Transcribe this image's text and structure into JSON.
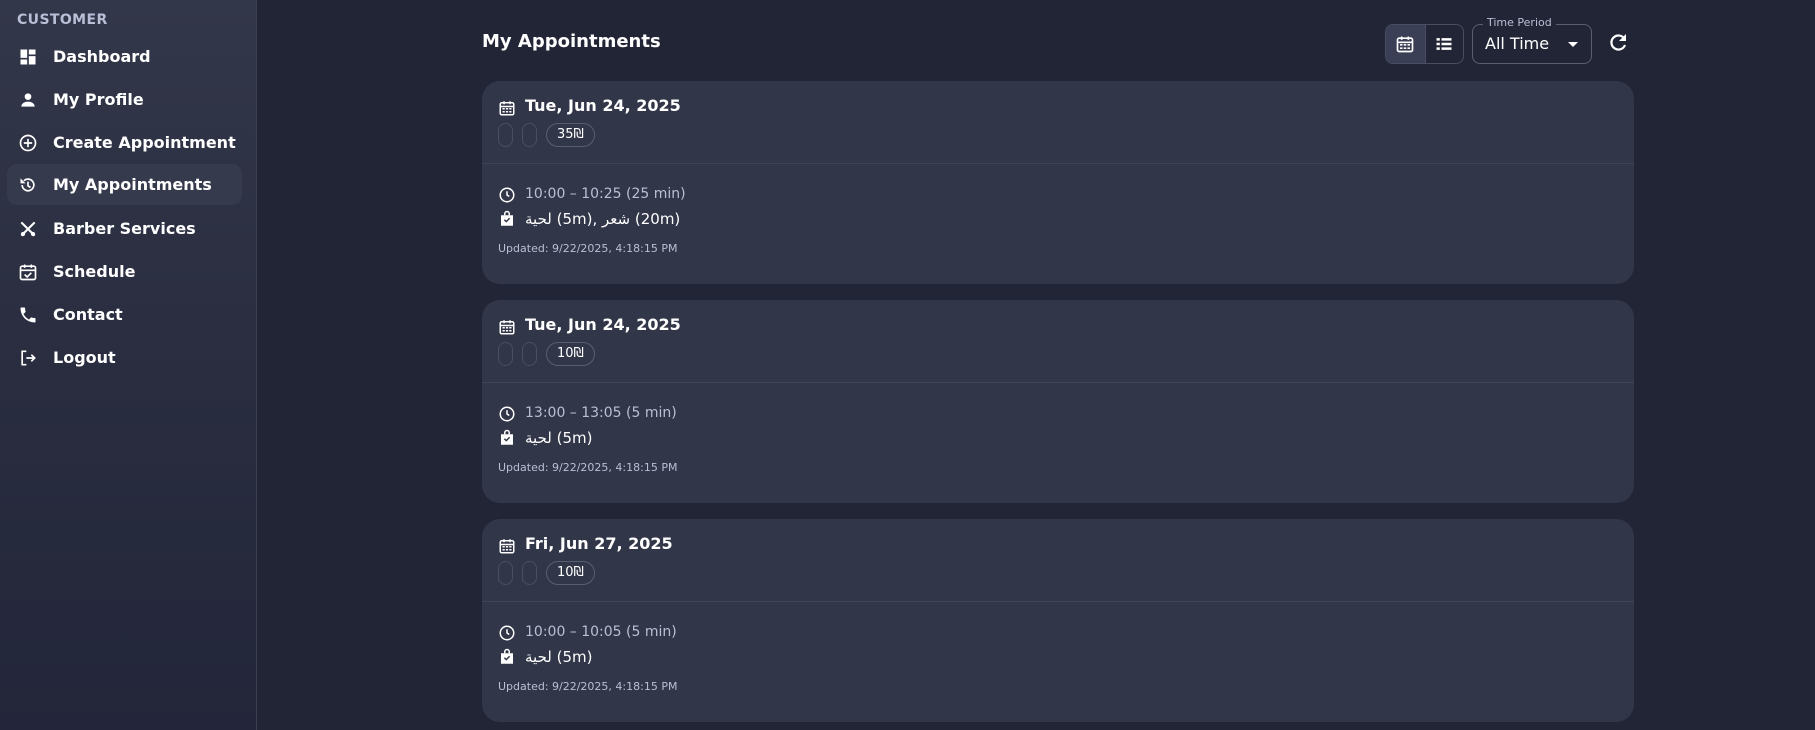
{
  "sidebar": {
    "section": "CUSTOMER",
    "items": [
      {
        "label": "Dashboard",
        "icon": "dashboard-icon"
      },
      {
        "label": "My Profile",
        "icon": "person-icon"
      },
      {
        "label": "Create Appointment",
        "icon": "add-circle-icon"
      },
      {
        "label": "My Appointments",
        "icon": "history-icon",
        "active": true
      },
      {
        "label": "Barber Services",
        "icon": "tools-icon"
      },
      {
        "label": "Schedule",
        "icon": "calendar-check-icon"
      },
      {
        "label": "Contact",
        "icon": "phone-icon"
      },
      {
        "label": "Logout",
        "icon": "logout-icon"
      }
    ]
  },
  "header": {
    "title": "My Appointments",
    "time_period": {
      "legend": "Time Period",
      "value": "All Time"
    },
    "view_mode": "calendar"
  },
  "appointments": [
    {
      "date": "Tue, Jun 24, 2025",
      "price": "35₪",
      "time": "10:00 – 10:25 (25 min)",
      "services": "لحية (5m), شعر (20m)",
      "updated": "Updated: 9/22/2025, 4:18:15 PM"
    },
    {
      "date": "Tue, Jun 24, 2025",
      "price": "10₪",
      "time": "13:00 – 13:05 (5 min)",
      "services": "لحية (5m)",
      "updated": "Updated: 9/22/2025, 4:18:15 PM"
    },
    {
      "date": "Fri, Jun 27, 2025",
      "price": "10₪",
      "time": "10:00 – 10:05 (5 min)",
      "services": "لحية (5m)",
      "updated": "Updated: 9/22/2025, 4:18:15 PM"
    }
  ],
  "colors": {
    "background": "#222536",
    "card": "#323649",
    "sidebar_top": "#323749",
    "muted_text": "#b9bfd6",
    "active_item": "#363a4d"
  }
}
